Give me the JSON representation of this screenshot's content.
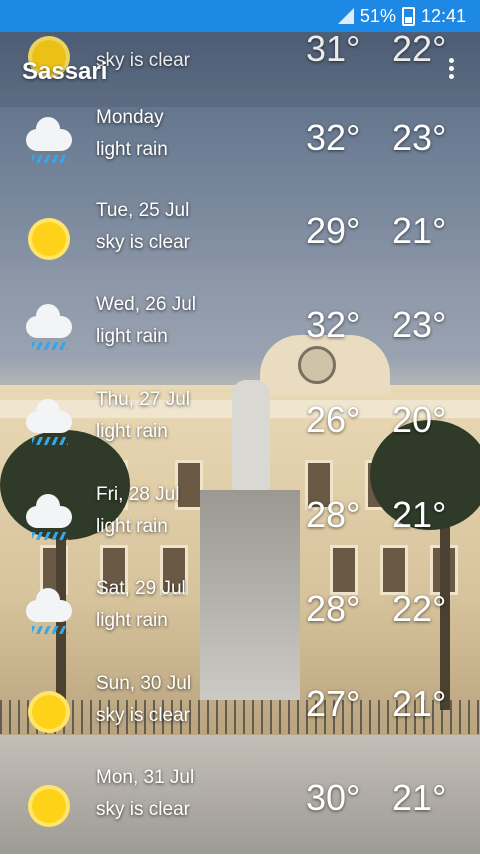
{
  "status_bar": {
    "battery": "51%",
    "time": "12:41"
  },
  "app": {
    "city": "Sassari"
  },
  "forecast": [
    {
      "day": "",
      "condition": "sky is clear",
      "high": "31°",
      "low": "22°",
      "icon": "sun-icon"
    },
    {
      "day": "Monday",
      "condition": "light rain",
      "high": "32°",
      "low": "23°",
      "icon": "rain-icon"
    },
    {
      "day": "Tue, 25 Jul",
      "condition": "sky is clear",
      "high": "29°",
      "low": "21°",
      "icon": "sun-icon"
    },
    {
      "day": "Wed, 26 Jul",
      "condition": "light rain",
      "high": "32°",
      "low": "23°",
      "icon": "rain-icon"
    },
    {
      "day": "Thu, 27 Jul",
      "condition": "light rain",
      "high": "26°",
      "low": "20°",
      "icon": "rain-icon"
    },
    {
      "day": "Fri, 28 Jul",
      "condition": "light rain",
      "high": "28°",
      "low": "21°",
      "icon": "rain-icon"
    },
    {
      "day": "Sat, 29 Jul",
      "condition": "light rain",
      "high": "28°",
      "low": "22°",
      "icon": "rain-icon"
    },
    {
      "day": "Sun, 30 Jul",
      "condition": "sky is clear",
      "high": "27°",
      "low": "21°",
      "icon": "sun-icon"
    },
    {
      "day": "Mon, 31 Jul",
      "condition": "sky is clear",
      "high": "30°",
      "low": "21°",
      "icon": "sun-icon"
    }
  ]
}
